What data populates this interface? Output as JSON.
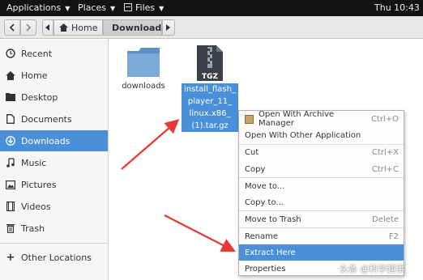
{
  "topbar": {
    "applications": "Applications",
    "places": "Places",
    "files": "Files",
    "clock": "Thu 10:43"
  },
  "header": {
    "home": "Home",
    "downloads": "Downloads"
  },
  "sidebar": {
    "items": [
      {
        "label": "Recent",
        "icon": "clock-icon"
      },
      {
        "label": "Home",
        "icon": "home-icon"
      },
      {
        "label": "Desktop",
        "icon": "desktop-icon"
      },
      {
        "label": "Documents",
        "icon": "document-icon"
      },
      {
        "label": "Downloads",
        "icon": "download-icon"
      },
      {
        "label": "Music",
        "icon": "music-icon"
      },
      {
        "label": "Pictures",
        "icon": "picture-icon"
      },
      {
        "label": "Videos",
        "icon": "video-icon"
      },
      {
        "label": "Trash",
        "icon": "trash-icon"
      }
    ],
    "other": "Other Locations"
  },
  "content": {
    "folder_label": "downloads",
    "file_badge": "TGZ",
    "file_lines": [
      "install_flash_",
      "player_11_",
      "linux.x86_",
      "(1).tar.gz"
    ]
  },
  "menu": {
    "items": [
      {
        "label": "Open With Archive Manager",
        "accel": "Ctrl+O"
      },
      {
        "label": "Open With Other Application",
        "accel": ""
      },
      {
        "label": "Cut",
        "accel": "Ctrl+X"
      },
      {
        "label": "Copy",
        "accel": "Ctrl+C"
      },
      {
        "label": "Move to...",
        "accel": ""
      },
      {
        "label": "Copy to...",
        "accel": ""
      },
      {
        "label": "Move to Trash",
        "accel": "Delete"
      },
      {
        "label": "Rename",
        "accel": "F2"
      },
      {
        "label": "Extract Here",
        "accel": ""
      },
      {
        "label": "Properties",
        "accel": ""
      }
    ]
  },
  "colors": {
    "accent": "#4a90d9",
    "arrow": "#e53935",
    "topbar": "#131313"
  },
  "watermark": "头条 @科学趣事"
}
